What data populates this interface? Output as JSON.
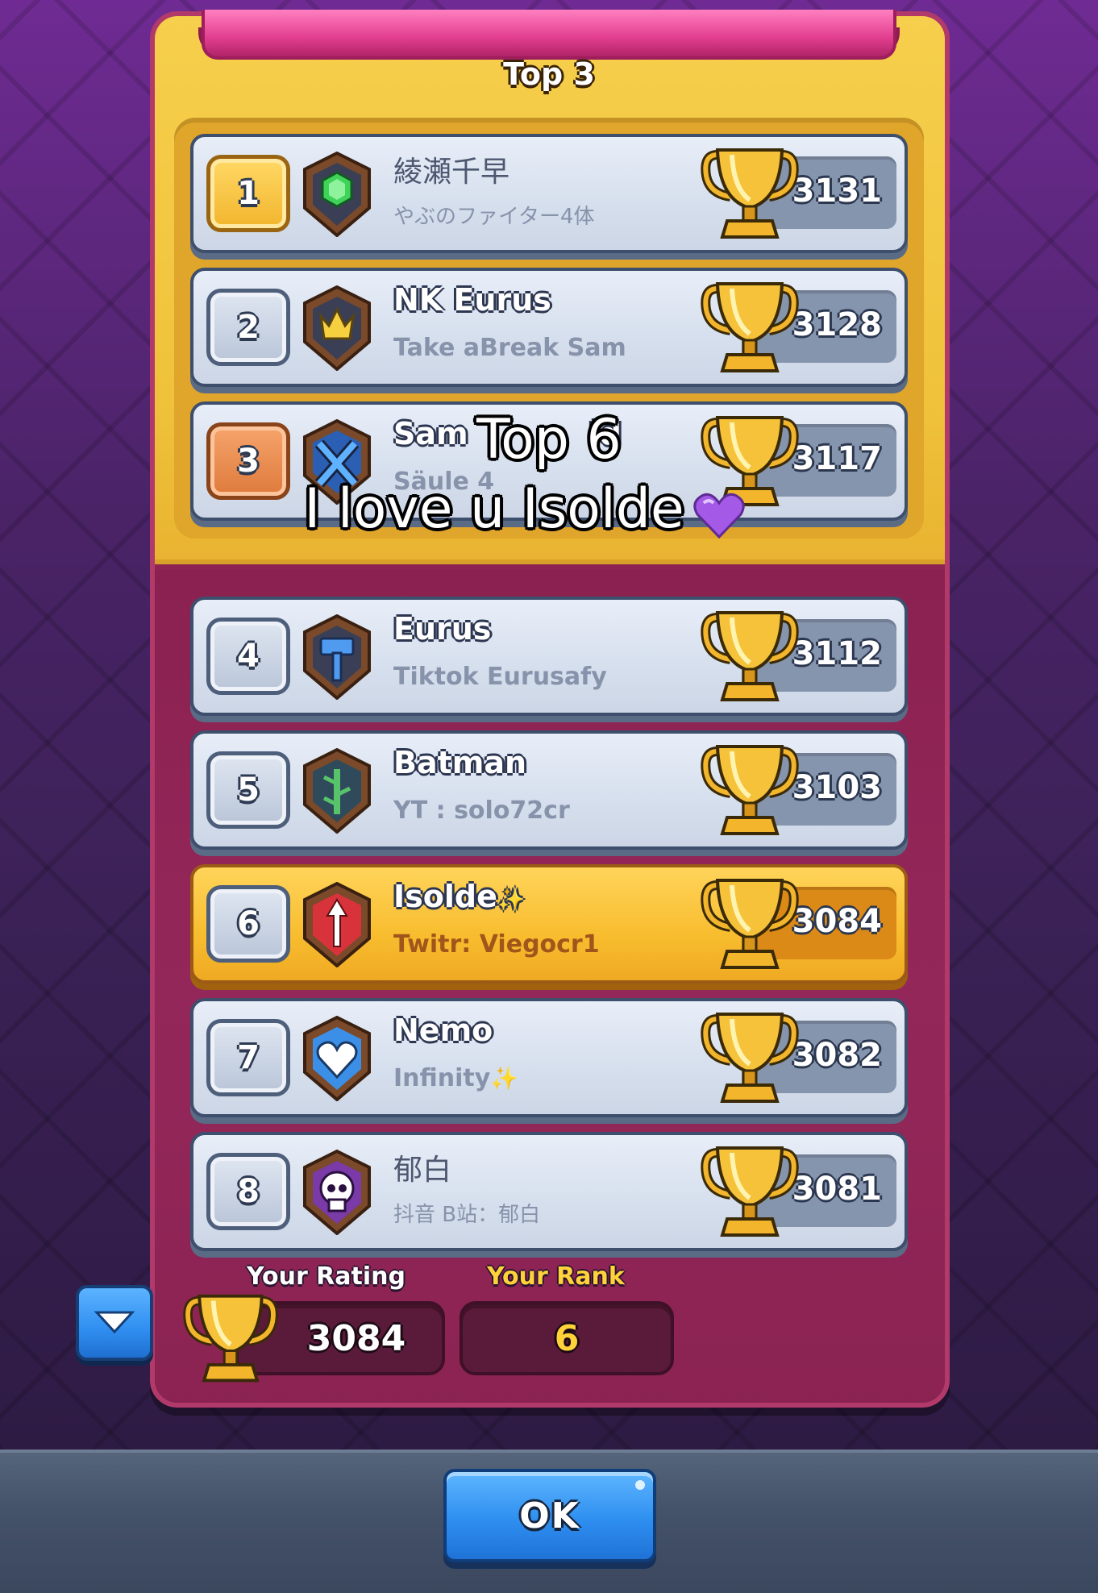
{
  "header": {
    "title": "Top 3"
  },
  "overlay": {
    "line1": "Top 6",
    "line2": "I love u Isolde"
  },
  "top3": [
    {
      "rank": "1",
      "name": "綾瀬千早",
      "clan": "やぶのファイター4体",
      "trophies": "3131",
      "rank_style": "gold",
      "badge": "green-gem-icon",
      "cjk": true
    },
    {
      "rank": "2",
      "name": "NK Eurus",
      "clan": "Take aBreak Sam",
      "trophies": "3128",
      "rank_style": "silver",
      "badge": "crown-icon",
      "cjk": false
    },
    {
      "rank": "3",
      "name": "Sam",
      "name_tail": "ld",
      "clan": "Säule 4",
      "trophies": "3117",
      "rank_style": "bronze",
      "badge": "crossed-swords-icon",
      "cjk": false
    }
  ],
  "list": [
    {
      "rank": "4",
      "name": "Eurus",
      "clan": "Tiktok Eurusafy",
      "trophies": "3112",
      "badge": "hammer-icon"
    },
    {
      "rank": "5",
      "name": "Batman",
      "clan": "YT : solo72cr",
      "trophies": "3103",
      "badge": "bamboo-icon"
    },
    {
      "rank": "6",
      "name": "Isolde",
      "clan": "Twitr: Viegocr1",
      "trophies": "3084",
      "badge": "arrow-icon",
      "highlight": true
    },
    {
      "rank": "7",
      "name": "Nemo",
      "clan": "Infinity",
      "trophies": "3082",
      "badge": "heart-icon"
    },
    {
      "rank": "8",
      "name": "郁白",
      "clan": "抖音 B站：郁白",
      "trophies": "3081",
      "badge": "skull-icon",
      "cjk": true
    }
  ],
  "summary": {
    "rating_label": "Your Rating",
    "rating_value": "3084",
    "rank_label": "Your Rank",
    "rank_value": "6"
  },
  "footer": {
    "ok_label": "OK"
  },
  "colors": {
    "panel_gold": "#f0c23b",
    "panel_magenta": "#8d2452",
    "button_blue": "#2e8ff0",
    "highlight_row": "#f8bd2f"
  }
}
